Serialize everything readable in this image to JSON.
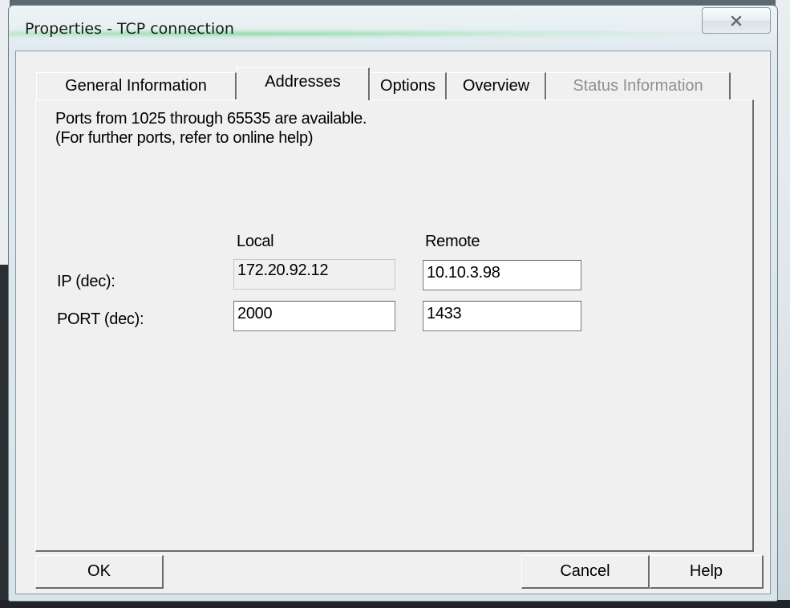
{
  "window": {
    "title": "Properties - TCP connection"
  },
  "tabs": [
    {
      "label": "General Information",
      "state": "normal"
    },
    {
      "label": "Addresses",
      "state": "active"
    },
    {
      "label": "Options",
      "state": "normal"
    },
    {
      "label": "Overview",
      "state": "normal"
    },
    {
      "label": "Status Information",
      "state": "disabled"
    }
  ],
  "addresses": {
    "info_line1": "Ports from 1025 through 65535 are available.",
    "info_line2": "(For further ports, refer to online help)",
    "col_local": "Local",
    "col_remote": "Remote",
    "ip_label": "IP (dec):",
    "port_label": "PORT (dec):",
    "local_ip": "172.20.92.12",
    "remote_ip": "10.10.3.98",
    "local_port": "2000",
    "remote_port": "1433"
  },
  "buttons": {
    "ok": "OK",
    "cancel": "Cancel",
    "help": "Help"
  },
  "icons": {
    "close": "close-icon"
  }
}
